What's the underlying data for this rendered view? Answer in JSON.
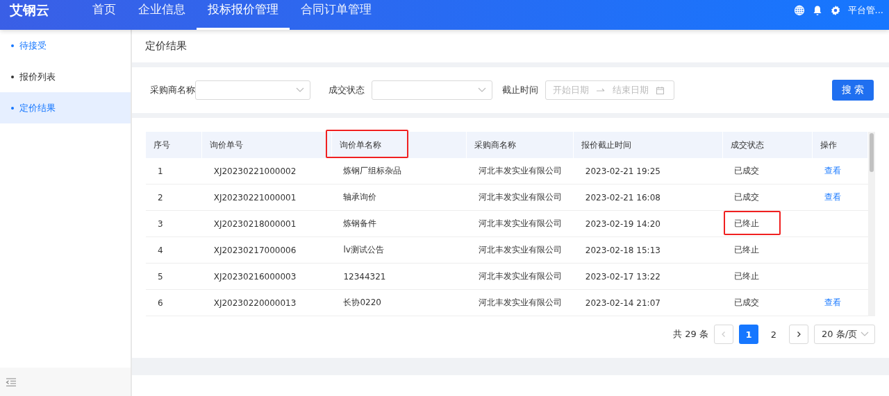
{
  "top_nav": {
    "logo": "艾钢云",
    "items": [
      {
        "label": "首页",
        "selected": false
      },
      {
        "label": "企业信息",
        "selected": false
      },
      {
        "label": "投标报价管理",
        "selected": true
      },
      {
        "label": "合同订单管理",
        "selected": false
      }
    ],
    "user": "平台管..."
  },
  "sidebar": {
    "items": [
      {
        "label": "待接受",
        "selected": false,
        "hovered": true
      },
      {
        "label": "报价列表",
        "selected": false,
        "hovered": false
      },
      {
        "label": "定价结果",
        "selected": true,
        "hovered": false
      }
    ]
  },
  "page_title": "定价结果",
  "filters": {
    "buyer_label": "采购商名称",
    "status_label": "成交状态",
    "deadline_label": "截止时间",
    "start_placeholder": "开始日期",
    "end_placeholder": "结束日期",
    "search_button": "搜 索"
  },
  "table": {
    "columns": [
      {
        "label": "序号",
        "highlighted": false
      },
      {
        "label": "询价单号",
        "highlighted": false
      },
      {
        "label": "询价单名称",
        "highlighted": true
      },
      {
        "label": "采购商名称",
        "highlighted": false
      },
      {
        "label": "报价截止时间",
        "highlighted": false
      },
      {
        "label": "成交状态",
        "highlighted": false
      },
      {
        "label": "操作",
        "highlighted": false
      }
    ],
    "rows": [
      {
        "index": "1",
        "number": "XJ20230221000002",
        "name": "炼钢厂组标杂品",
        "buyer": "河北丰发实业有限公司",
        "deadline": "2023-02-21 19:25",
        "status": "已成交",
        "status_highlighted": false,
        "action": "查看"
      },
      {
        "index": "2",
        "number": "XJ20230221000001",
        "name": "轴承询价",
        "buyer": "河北丰发实业有限公司",
        "deadline": "2023-02-21 16:08",
        "status": "已成交",
        "status_highlighted": false,
        "action": "查看"
      },
      {
        "index": "3",
        "number": "XJ20230218000001",
        "name": "炼钢备件",
        "buyer": "河北丰发实业有限公司",
        "deadline": "2023-02-19 14:20",
        "status": "已终止",
        "status_highlighted": true
      },
      {
        "index": "4",
        "number": "XJ20230217000006",
        "name": "lv测试公告",
        "buyer": "河北丰发实业有限公司",
        "deadline": "2023-02-18 15:13",
        "status": "已终止",
        "status_highlighted": false
      },
      {
        "index": "5",
        "number": "XJ20230216000003",
        "name": "12344321",
        "buyer": "河北丰发实业有限公司",
        "deadline": "2023-02-17 13:22",
        "status": "已终止",
        "status_highlighted": false
      },
      {
        "index": "6",
        "number": "XJ20230220000013",
        "name": "长协0220",
        "buyer": "河北丰发实业有限公司",
        "deadline": "2023-02-14 21:07",
        "status": "已成交",
        "status_highlighted": false,
        "action": "查看"
      }
    ]
  },
  "pagination": {
    "total": "共 29 条",
    "pages": [
      {
        "label": "1",
        "selected": true
      },
      {
        "label": "2",
        "selected": false
      }
    ],
    "page_size": "20 条/页"
  }
}
